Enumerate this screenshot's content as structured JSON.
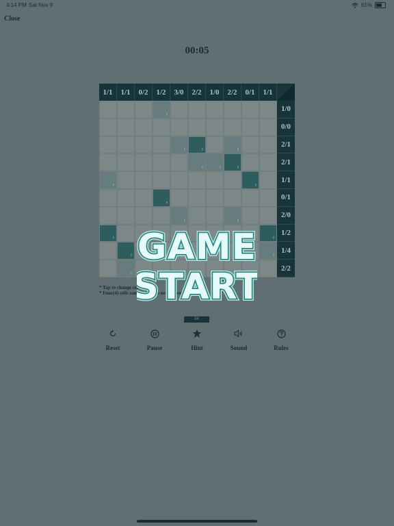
{
  "status_bar": {
    "time": "4:14 PM",
    "date": "Sat Nov 9",
    "battery_percent": "61%",
    "wifi_icon": "wifi-icon",
    "battery_icon": "battery-icon"
  },
  "nav": {
    "close_label": "Close"
  },
  "timer": "00:05",
  "board": {
    "column_headers": [
      "1/1",
      "1/1",
      "0/2",
      "1/2",
      "3/0",
      "2/2",
      "1/0",
      "2/2",
      "0/1",
      "1/1"
    ],
    "row_headers": [
      "1/0",
      "0/0",
      "2/1",
      "2/1",
      "1/1",
      "0/1",
      "2/0",
      "1/2",
      "1/4",
      "2/2"
    ],
    "cells": [
      [
        "",
        "",
        "",
        "mid",
        "",
        "",
        "",
        "",
        "",
        ""
      ],
      [
        "",
        "",
        "",
        "",
        "",
        "",
        "",
        "",
        "",
        ""
      ],
      [
        "",
        "",
        "",
        "",
        "mid",
        "dark",
        "",
        "mid",
        "",
        ""
      ],
      [
        "",
        "",
        "",
        "",
        "",
        "mid",
        "mid",
        "dark",
        "",
        ""
      ],
      [
        "mid",
        "",
        "",
        "",
        "",
        "",
        "",
        "",
        "dark",
        ""
      ],
      [
        "",
        "",
        "",
        "dark",
        "",
        "",
        "",
        "",
        "",
        ""
      ],
      [
        "",
        "",
        "",
        "",
        "mid",
        "",
        "",
        "mid",
        "",
        ""
      ],
      [
        "dark",
        "",
        "",
        "",
        "",
        "",
        "",
        "",
        "",
        "dark"
      ],
      [
        "",
        "dark",
        "",
        "",
        "",
        "",
        "",
        "",
        "",
        "mid"
      ],
      [
        "",
        "mid",
        "",
        "",
        "",
        "",
        "",
        "",
        "",
        ""
      ]
    ]
  },
  "notes": [
    "* Tap to change cell color",
    "* Four(4) cells same color are not allowed"
  ],
  "counter": "64",
  "toolbar": {
    "reset": "Reset",
    "pause": "Pause",
    "hint": "Hint",
    "sound": "Sound",
    "rules": "Rules"
  },
  "overlay": {
    "line1": "GAME",
    "line2": "START"
  },
  "colors": {
    "background": "#5f6f72",
    "header": "#16343a",
    "cell_dark": "#2e5d5e",
    "accent": "#1f8a86"
  }
}
